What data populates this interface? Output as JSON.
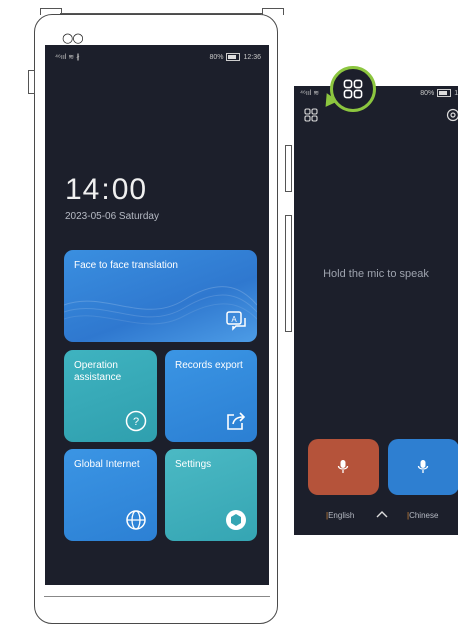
{
  "device": {
    "status_left": "⁴⁶ııl ≋ ∦",
    "battery_percent": "80%",
    "time": "12:36"
  },
  "home": {
    "clock_hours": "14",
    "clock_sep": ":",
    "clock_minutes": "00",
    "date": "2023-05-06 Saturday",
    "tiles": {
      "face_to_face": "Face to face translation",
      "operation_assistance": "Operation assistance",
      "records_export": "Records export",
      "global_internet": "Global Internet",
      "settings": "Settings"
    }
  },
  "translate_panel": {
    "status_left": "⁴⁶ııl ≋",
    "battery_percent": "80%",
    "time": "12",
    "prompt": "Hold the mic to speak",
    "lang_left": "English",
    "lang_right": "Chinese"
  },
  "colors": {
    "screen_bg": "#1c1f2b",
    "tile_blue": "#2f7fd1",
    "tile_teal": "#3aaab7",
    "mic_english": "#b5533a",
    "mic_chinese": "#2e7fd1",
    "callout_border": "#8cc63f"
  }
}
